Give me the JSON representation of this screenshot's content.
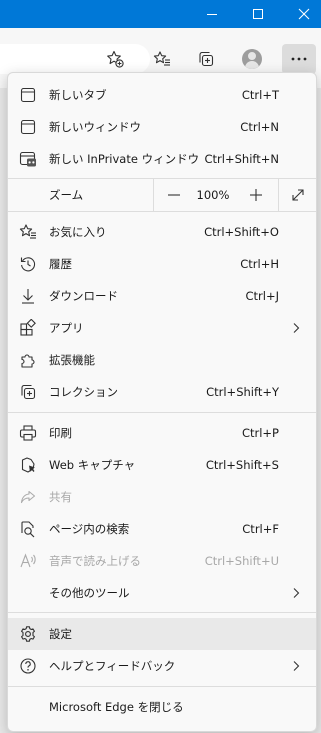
{
  "menu": {
    "new_tab": {
      "label": "新しいタブ",
      "shortcut": "Ctrl+T"
    },
    "new_window": {
      "label": "新しいウィンドウ",
      "shortcut": "Ctrl+N"
    },
    "new_inprivate": {
      "label": "新しい InPrivate ウィンドウ",
      "shortcut": "Ctrl+Shift+N"
    },
    "zoom": {
      "label": "ズーム",
      "value": "100%",
      "minus": "—",
      "plus": "+"
    },
    "favorites": {
      "label": "お気に入り",
      "shortcut": "Ctrl+Shift+O"
    },
    "history": {
      "label": "履歴",
      "shortcut": "Ctrl+H"
    },
    "downloads": {
      "label": "ダウンロード",
      "shortcut": "Ctrl+J"
    },
    "apps": {
      "label": "アプリ"
    },
    "extensions": {
      "label": "拡張機能"
    },
    "collections": {
      "label": "コレクション",
      "shortcut": "Ctrl+Shift+Y"
    },
    "print": {
      "label": "印刷",
      "shortcut": "Ctrl+P"
    },
    "web_capture": {
      "label": "Web キャプチャ",
      "shortcut": "Ctrl+Shift+S"
    },
    "share": {
      "label": "共有",
      "disabled": true
    },
    "find": {
      "label": "ページ内の検索",
      "shortcut": "Ctrl+F"
    },
    "read_aloud": {
      "label": "音声で読み上げる",
      "shortcut": "Ctrl+Shift+U",
      "disabled": true
    },
    "more_tools": {
      "label": "その他のツール"
    },
    "settings": {
      "label": "設定",
      "highlighted": true
    },
    "help": {
      "label": "ヘルプとフィードバック"
    },
    "close_edge": {
      "label": "Microsoft Edge を閉じる"
    }
  },
  "icons": {
    "titlebar": [
      "minimize-icon",
      "maximize-icon",
      "close-icon"
    ],
    "toolbar": [
      "add-favorite-icon",
      "favorites-icon",
      "collections-icon",
      "profile-avatar",
      "more-icon"
    ]
  },
  "colors": {
    "titlebar": "#0078d7",
    "menu_bg": "#f9f9f9",
    "highlight": "#e9e9e9",
    "disabled_text": "#a8a8a8"
  }
}
